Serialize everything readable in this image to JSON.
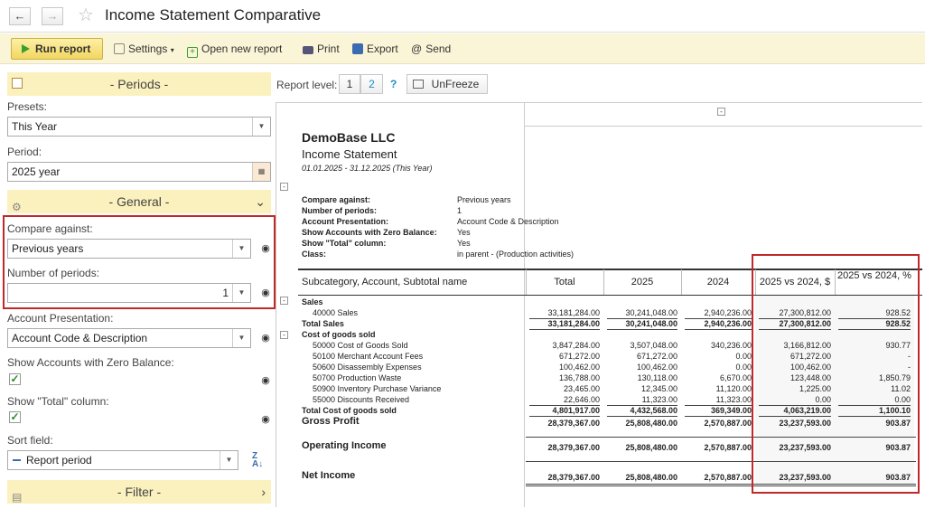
{
  "window": {
    "title": "Income Statement Comparative"
  },
  "toolbar": {
    "run": "Run report",
    "settings": "Settings",
    "new_report": "Open new report",
    "print": "Print",
    "export": "Export",
    "send": "Send"
  },
  "left": {
    "periods_header": "- Periods -",
    "presets_label": "Presets:",
    "presets_value": "This Year",
    "period_label": "Period:",
    "period_value": "2025 year",
    "general_header": "- General -",
    "compare_label": "Compare against:",
    "compare_value": "Previous years",
    "num_periods_label": "Number of periods:",
    "num_periods_value": "1",
    "acc_pres_label": "Account Presentation:",
    "acc_pres_value": "Account Code & Description",
    "zero_bal_label": "Show Accounts with Zero Balance:",
    "total_col_label": "Show \"Total\" column:",
    "sort_label": "Sort field:",
    "sort_value": "Report period",
    "filter_header": "- Filter -"
  },
  "report_bar": {
    "level_label": "Report level:",
    "level1": "1",
    "level2": "2",
    "help": "?",
    "unfreeze": "UnFreeze"
  },
  "report": {
    "company": "DemoBase LLC",
    "title": "Income Statement",
    "period": "01.01.2025 - 31.12.2025 (This Year)",
    "params": [
      {
        "k": "Compare against:",
        "v": "Previous years"
      },
      {
        "k": "Number of periods:",
        "v": "1"
      },
      {
        "k": "Account Presentation:",
        "v": "Account Code & Description"
      },
      {
        "k": "Show Accounts with Zero Balance:",
        "v": "Yes"
      },
      {
        "k": "Show \"Total\" column:",
        "v": "Yes"
      },
      {
        "k": "Class:",
        "v": "in parent - (Production activities)"
      }
    ],
    "headers": [
      "Subcategory, Account, Subtotal name",
      "Total",
      "2025",
      "2024",
      "2025 vs 2024, $",
      "2025 vs 2024, %"
    ],
    "rows": [
      {
        "name": "Sales",
        "vals": [
          "",
          "",
          "",
          "",
          ""
        ],
        "style": "cat"
      },
      {
        "name": "40000 Sales",
        "vals": [
          "33,181,284.00",
          "30,241,048.00",
          "2,940,236.00",
          "27,300,812.00",
          "928.52"
        ],
        "style": "acc"
      },
      {
        "name": "Total Sales",
        "vals": [
          "33,181,284.00",
          "30,241,048.00",
          "2,940,236.00",
          "27,300,812.00",
          "928.52"
        ],
        "style": "tot"
      },
      {
        "name": "Cost of goods sold",
        "vals": [
          "",
          "",
          "",
          "",
          ""
        ],
        "style": "cat"
      },
      {
        "name": "50000 Cost of Goods Sold",
        "vals": [
          "3,847,284.00",
          "3,507,048.00",
          "340,236.00",
          "3,166,812.00",
          "930.77"
        ],
        "style": "acc"
      },
      {
        "name": "50100 Merchant Account Fees",
        "vals": [
          "671,272.00",
          "671,272.00",
          "0.00",
          "671,272.00",
          "-"
        ],
        "style": "acc"
      },
      {
        "name": "50600 Disassembly Expenses",
        "vals": [
          "100,462.00",
          "100,462.00",
          "0.00",
          "100,462.00",
          "-"
        ],
        "style": "acc"
      },
      {
        "name": "50700 Production Waste",
        "vals": [
          "136,788.00",
          "130,118.00",
          "6,670.00",
          "123,448.00",
          "1,850.79"
        ],
        "style": "acc"
      },
      {
        "name": "50900 Inventory Purchase Variance",
        "vals": [
          "23,465.00",
          "12,345.00",
          "11,120.00",
          "1,225.00",
          "11.02"
        ],
        "style": "acc"
      },
      {
        "name": "55000 Discounts Received",
        "vals": [
          "22,646.00",
          "11,323.00",
          "11,323.00",
          "0.00",
          "0.00"
        ],
        "style": "acc"
      },
      {
        "name": "Total Cost of goods sold",
        "vals": [
          "4,801,917.00",
          "4,432,568.00",
          "369,349.00",
          "4,063,219.00",
          "1,100.10"
        ],
        "style": "tot"
      }
    ],
    "gross": {
      "name": "Gross Profit",
      "vals": [
        "28,379,367.00",
        "25,808,480.00",
        "2,570,887.00",
        "23,237,593.00",
        "903.87"
      ]
    },
    "operating": {
      "name": "Operating Income",
      "vals": [
        "28,379,367.00",
        "25,808,480.00",
        "2,570,887.00",
        "23,237,593.00",
        "903.87"
      ]
    },
    "net": {
      "name": "Net Income",
      "vals": [
        "28,379,367.00",
        "25,808,480.00",
        "2,570,887.00",
        "23,237,593.00",
        "903.87"
      ]
    }
  },
  "colors": {
    "accent": "#fbf1be",
    "highlight": "#c0282a",
    "run_button": "#f2d660"
  }
}
